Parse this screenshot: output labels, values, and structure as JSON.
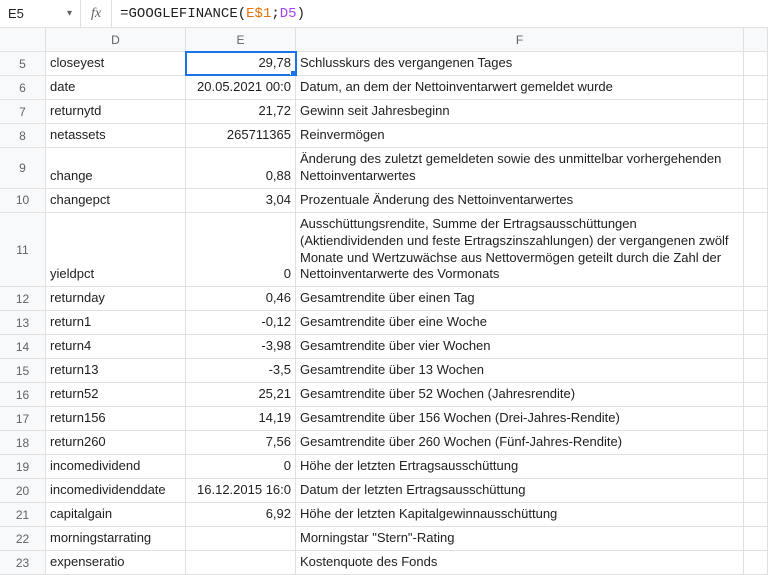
{
  "nameBox": "E5",
  "fxLabel": "fx",
  "formula": {
    "eq": "=",
    "fn": "GOOGLEFINANCE",
    "open": "(",
    "ref1": "E$1",
    "sep": ";",
    "ref2": "D5",
    "close": ")"
  },
  "columns": {
    "D": "D",
    "E": "E",
    "F": "F"
  },
  "rows": [
    {
      "n": "5",
      "d": "closeyest",
      "e": "29,78",
      "f": "Schlusskurs des vergangenen Tages",
      "active": true
    },
    {
      "n": "6",
      "d": "date",
      "e": "20.05.2021 00:0",
      "f": "Datum, an dem der Nettoinventarwert gemeldet wurde"
    },
    {
      "n": "7",
      "d": "returnytd",
      "e": "21,72",
      "f": "Gewinn seit Jahresbeginn"
    },
    {
      "n": "8",
      "d": "netassets",
      "e": "265711365",
      "f": "Reinvermögen"
    },
    {
      "n": "9",
      "d": "change",
      "e": "0,88",
      "f": "Änderung des zuletzt gemeldeten sowie des unmittelbar vorhergehenden Nettoinventarwertes",
      "tall": "tall-9"
    },
    {
      "n": "10",
      "d": "changepct",
      "e": "3,04",
      "f": "Prozentuale Änderung des Nettoinventarwertes"
    },
    {
      "n": "11",
      "d": "yieldpct",
      "e": "0",
      "f": "Ausschüttungsrendite, Summe der Ertragsausschüttungen (Aktiendividenden und feste Ertragszinszahlungen) der vergangenen zwölf Monate und Wertzuwächse aus Nettovermögen geteilt durch die Zahl der Nettoinventarwerte des Vormonats",
      "tall": "tall-11"
    },
    {
      "n": "12",
      "d": "returnday",
      "e": "0,46",
      "f": "Gesamtrendite über einen Tag"
    },
    {
      "n": "13",
      "d": "return1",
      "e": "-0,12",
      "f": "Gesamtrendite über eine Woche"
    },
    {
      "n": "14",
      "d": "return4",
      "e": "-3,98",
      "f": "Gesamtrendite über vier Wochen"
    },
    {
      "n": "15",
      "d": "return13",
      "e": "-3,5",
      "f": "Gesamtrendite über 13 Wochen"
    },
    {
      "n": "16",
      "d": "return52",
      "e": "25,21",
      "f": "Gesamtrendite über 52 Wochen (Jahresrendite)"
    },
    {
      "n": "17",
      "d": "return156",
      "e": "14,19",
      "f": "Gesamtrendite über 156 Wochen (Drei-Jahres-Rendite)"
    },
    {
      "n": "18",
      "d": "return260",
      "e": "7,56",
      "f": "Gesamtrendite über 260 Wochen (Fünf-Jahres-Rendite)"
    },
    {
      "n": "19",
      "d": "incomedividend",
      "e": "0",
      "f": "Höhe der letzten Ertragsausschüttung"
    },
    {
      "n": "20",
      "d": "incomedividenddate",
      "e": "16.12.2015 16:0",
      "f": "Datum der letzten Ertragsausschüttung"
    },
    {
      "n": "21",
      "d": "capitalgain",
      "e": "6,92",
      "f": "Höhe der letzten Kapitalgewinnausschüttung"
    },
    {
      "n": "22",
      "d": "morningstarrating",
      "e": "",
      "f": "Morningstar \"Stern\"-Rating"
    },
    {
      "n": "23",
      "d": "expenseratio",
      "e": "",
      "f": "Kostenquote des Fonds"
    }
  ]
}
